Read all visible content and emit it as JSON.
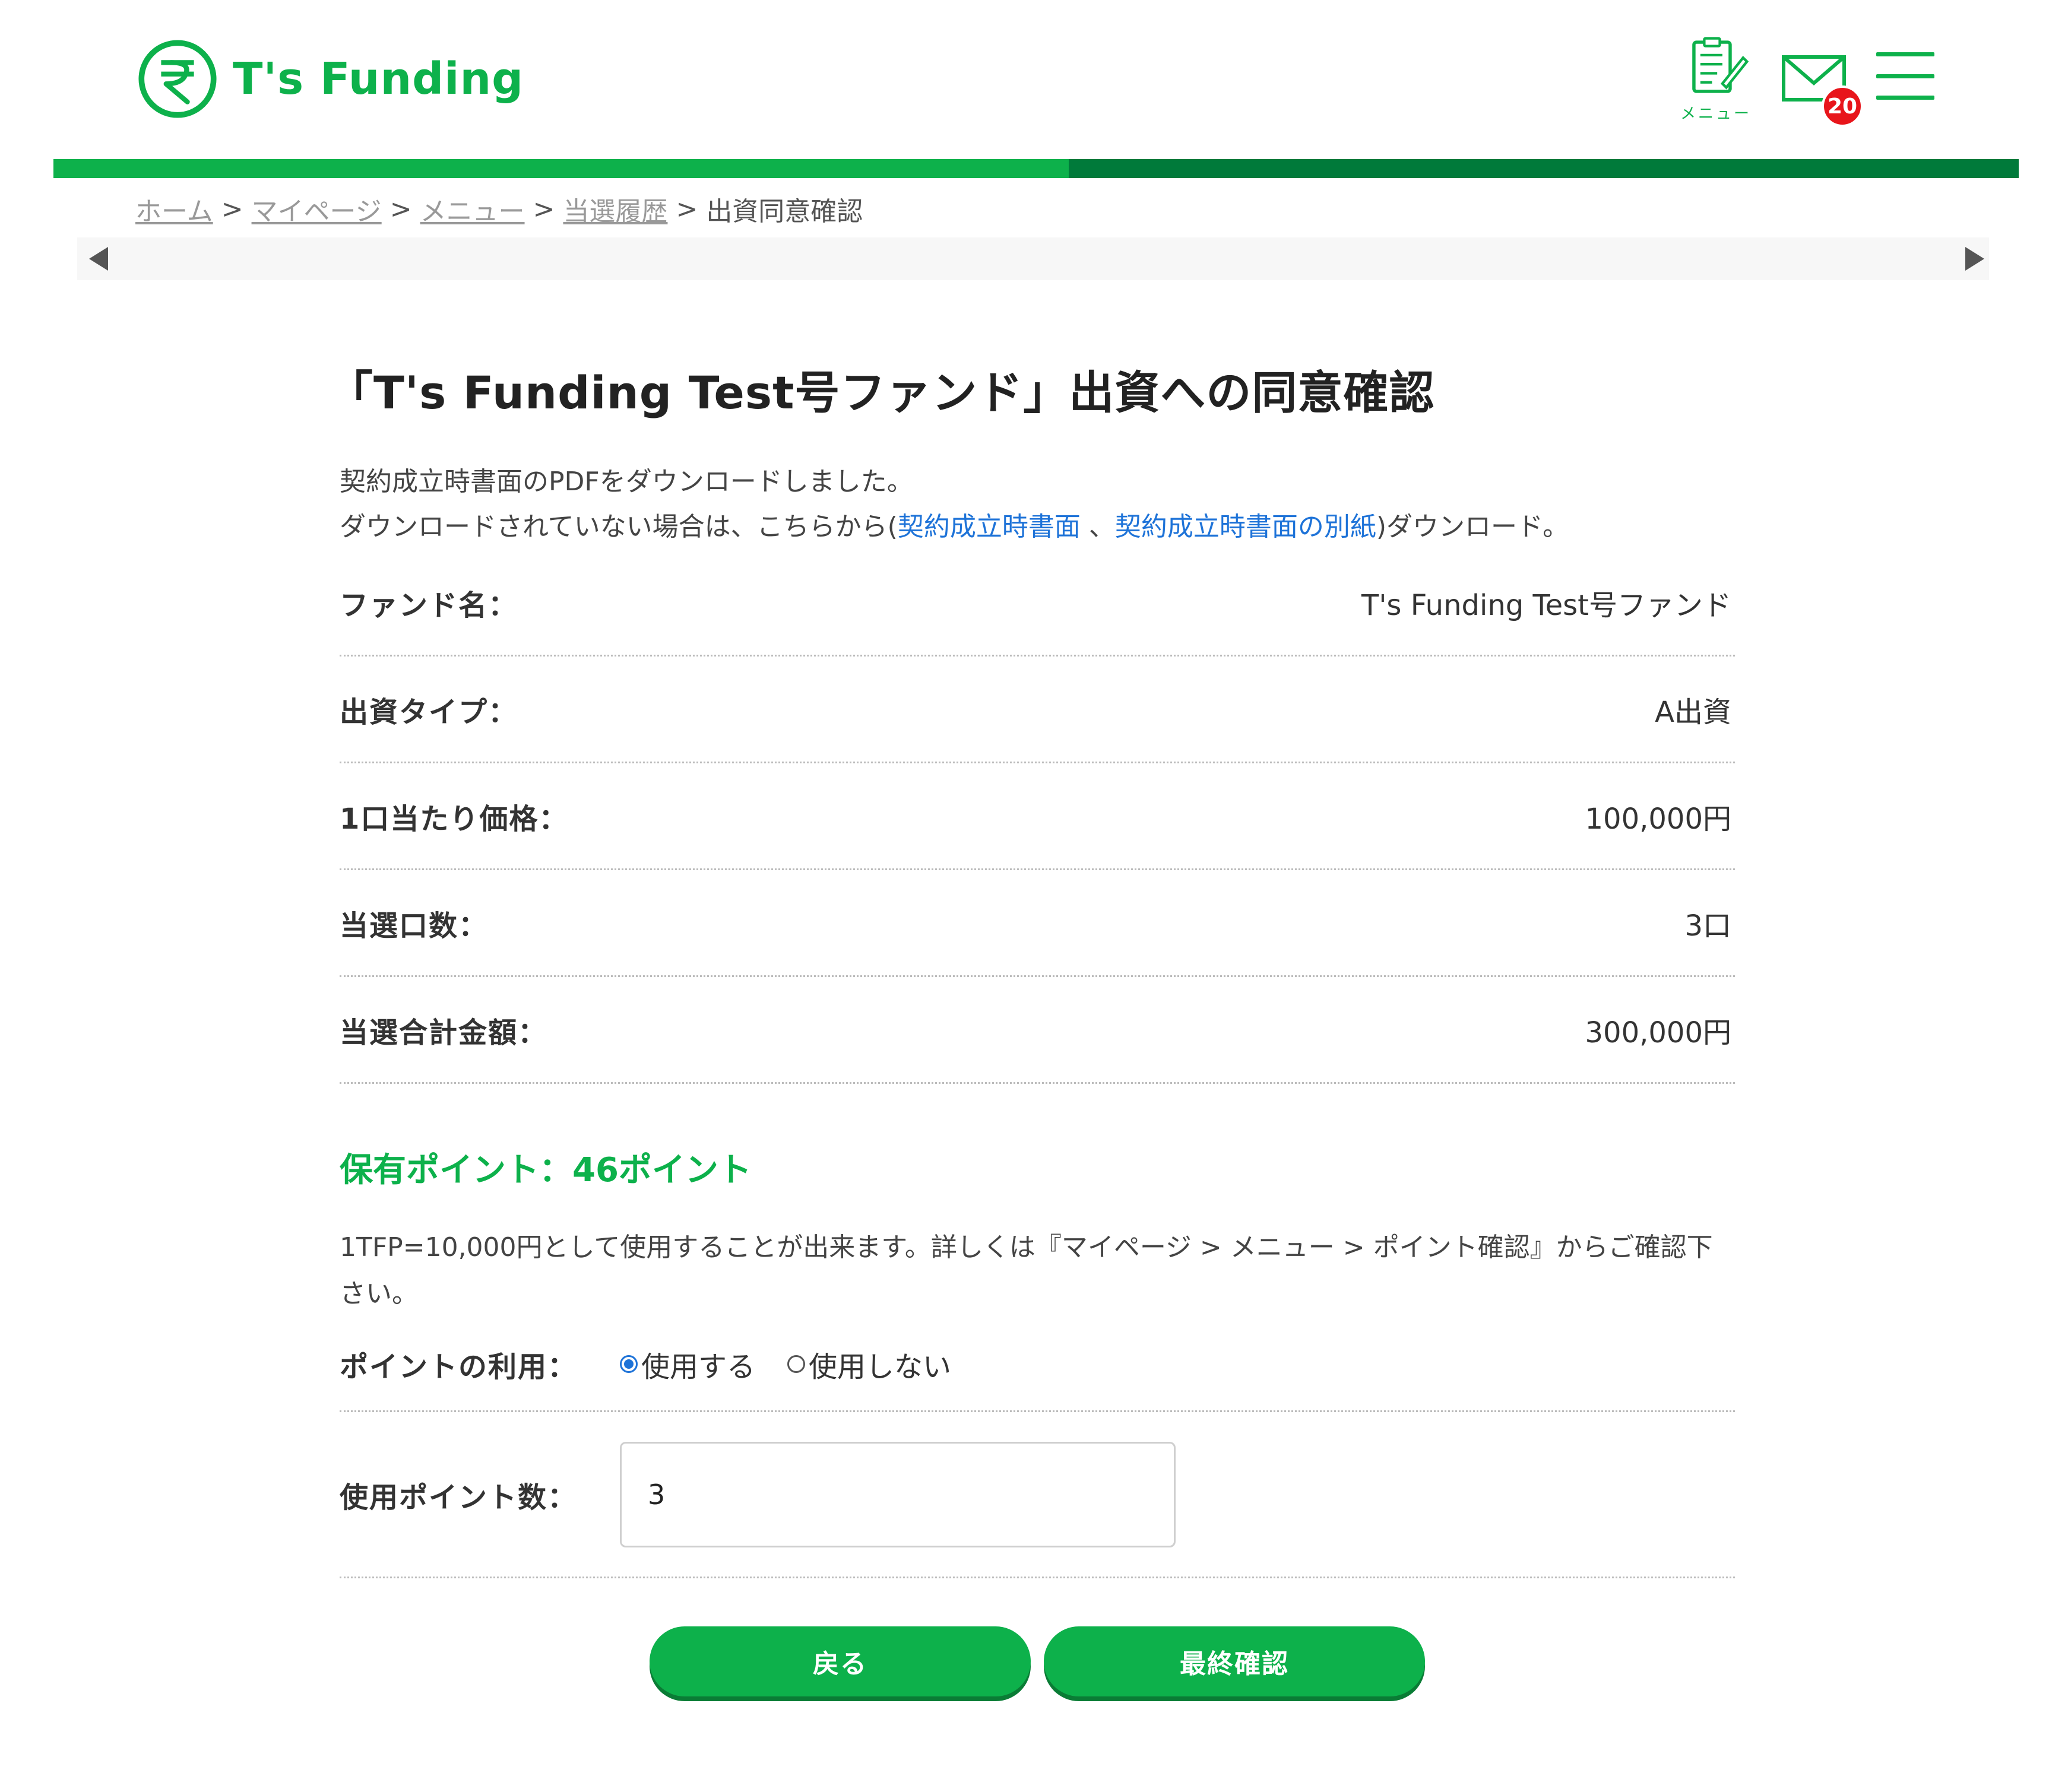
{
  "header": {
    "brand": "T's Funding",
    "menu_icon_label": "メニュー",
    "mail_badge_count": "20"
  },
  "breadcrumb": {
    "items": [
      "ホーム",
      "マイページ",
      "メニュー",
      "当選履歴"
    ],
    "current": "出資同意確認",
    "separator": ">"
  },
  "main": {
    "title": "「T's Funding Test号ファンド」出資への同意確認",
    "intro_line1": "契約成立時書面のPDFをダウンロードしました。",
    "intro_line2_prefix": "ダウンロードされていない場合は、こちらから(",
    "link_contract": "契約成立時書面",
    "intro_comma": "、",
    "link_contract_appendix": "契約成立時書面の別紙",
    "intro_line2_suffix": ")ダウンロード。",
    "details": [
      {
        "label": "ファンド名：",
        "value": "T's Funding Test号ファンド"
      },
      {
        "label": "出資タイプ：",
        "value": "A出資"
      },
      {
        "label": "1口当たり価格：",
        "value": "100,000円"
      },
      {
        "label": "当選口数：",
        "value": "3口"
      },
      {
        "label": "当選合計金額：",
        "value": "300,000円"
      }
    ],
    "points_heading": "保有ポイント：46ポイント",
    "points_note": "1TFP=10,000円として使用することが出来ます。詳しくは『マイページ > メニュー > ポイント確認』からご確認下さい。",
    "point_usage_label": "ポイントの利用：",
    "point_usage_options": [
      "使用する",
      "使用しない"
    ],
    "point_usage_selected": "使用する",
    "points_count_label": "使用ポイント数：",
    "points_count_value": "3"
  },
  "buttons": {
    "back": "戻る",
    "final_confirm": "最終確認"
  },
  "colors": {
    "brand_green": "#0db14b",
    "dark_green": "#007a3a",
    "link_blue": "#1e73d8",
    "badge_red": "#e8151b"
  }
}
